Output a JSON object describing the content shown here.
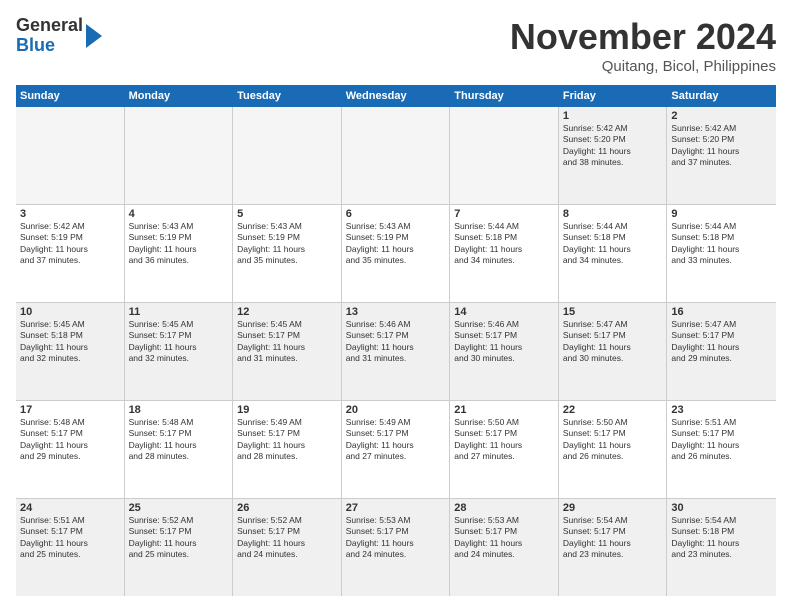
{
  "header": {
    "logo_general": "General",
    "logo_blue": "Blue",
    "month_title": "November 2024",
    "location": "Quitang, Bicol, Philippines"
  },
  "days_of_week": [
    "Sunday",
    "Monday",
    "Tuesday",
    "Wednesday",
    "Thursday",
    "Friday",
    "Saturday"
  ],
  "weeks": [
    [
      {
        "day": "",
        "empty": true,
        "text": ""
      },
      {
        "day": "",
        "empty": true,
        "text": ""
      },
      {
        "day": "",
        "empty": true,
        "text": ""
      },
      {
        "day": "",
        "empty": true,
        "text": ""
      },
      {
        "day": "",
        "empty": true,
        "text": ""
      },
      {
        "day": "1",
        "empty": false,
        "text": "Sunrise: 5:42 AM\nSunset: 5:20 PM\nDaylight: 11 hours\nand 38 minutes."
      },
      {
        "day": "2",
        "empty": false,
        "text": "Sunrise: 5:42 AM\nSunset: 5:20 PM\nDaylight: 11 hours\nand 37 minutes."
      }
    ],
    [
      {
        "day": "3",
        "empty": false,
        "text": "Sunrise: 5:42 AM\nSunset: 5:19 PM\nDaylight: 11 hours\nand 37 minutes."
      },
      {
        "day": "4",
        "empty": false,
        "text": "Sunrise: 5:43 AM\nSunset: 5:19 PM\nDaylight: 11 hours\nand 36 minutes."
      },
      {
        "day": "5",
        "empty": false,
        "text": "Sunrise: 5:43 AM\nSunset: 5:19 PM\nDaylight: 11 hours\nand 35 minutes."
      },
      {
        "day": "6",
        "empty": false,
        "text": "Sunrise: 5:43 AM\nSunset: 5:19 PM\nDaylight: 11 hours\nand 35 minutes."
      },
      {
        "day": "7",
        "empty": false,
        "text": "Sunrise: 5:44 AM\nSunset: 5:18 PM\nDaylight: 11 hours\nand 34 minutes."
      },
      {
        "day": "8",
        "empty": false,
        "text": "Sunrise: 5:44 AM\nSunset: 5:18 PM\nDaylight: 11 hours\nand 34 minutes."
      },
      {
        "day": "9",
        "empty": false,
        "text": "Sunrise: 5:44 AM\nSunset: 5:18 PM\nDaylight: 11 hours\nand 33 minutes."
      }
    ],
    [
      {
        "day": "10",
        "empty": false,
        "text": "Sunrise: 5:45 AM\nSunset: 5:18 PM\nDaylight: 11 hours\nand 32 minutes."
      },
      {
        "day": "11",
        "empty": false,
        "text": "Sunrise: 5:45 AM\nSunset: 5:17 PM\nDaylight: 11 hours\nand 32 minutes."
      },
      {
        "day": "12",
        "empty": false,
        "text": "Sunrise: 5:45 AM\nSunset: 5:17 PM\nDaylight: 11 hours\nand 31 minutes."
      },
      {
        "day": "13",
        "empty": false,
        "text": "Sunrise: 5:46 AM\nSunset: 5:17 PM\nDaylight: 11 hours\nand 31 minutes."
      },
      {
        "day": "14",
        "empty": false,
        "text": "Sunrise: 5:46 AM\nSunset: 5:17 PM\nDaylight: 11 hours\nand 30 minutes."
      },
      {
        "day": "15",
        "empty": false,
        "text": "Sunrise: 5:47 AM\nSunset: 5:17 PM\nDaylight: 11 hours\nand 30 minutes."
      },
      {
        "day": "16",
        "empty": false,
        "text": "Sunrise: 5:47 AM\nSunset: 5:17 PM\nDaylight: 11 hours\nand 29 minutes."
      }
    ],
    [
      {
        "day": "17",
        "empty": false,
        "text": "Sunrise: 5:48 AM\nSunset: 5:17 PM\nDaylight: 11 hours\nand 29 minutes."
      },
      {
        "day": "18",
        "empty": false,
        "text": "Sunrise: 5:48 AM\nSunset: 5:17 PM\nDaylight: 11 hours\nand 28 minutes."
      },
      {
        "day": "19",
        "empty": false,
        "text": "Sunrise: 5:49 AM\nSunset: 5:17 PM\nDaylight: 11 hours\nand 28 minutes."
      },
      {
        "day": "20",
        "empty": false,
        "text": "Sunrise: 5:49 AM\nSunset: 5:17 PM\nDaylight: 11 hours\nand 27 minutes."
      },
      {
        "day": "21",
        "empty": false,
        "text": "Sunrise: 5:50 AM\nSunset: 5:17 PM\nDaylight: 11 hours\nand 27 minutes."
      },
      {
        "day": "22",
        "empty": false,
        "text": "Sunrise: 5:50 AM\nSunset: 5:17 PM\nDaylight: 11 hours\nand 26 minutes."
      },
      {
        "day": "23",
        "empty": false,
        "text": "Sunrise: 5:51 AM\nSunset: 5:17 PM\nDaylight: 11 hours\nand 26 minutes."
      }
    ],
    [
      {
        "day": "24",
        "empty": false,
        "text": "Sunrise: 5:51 AM\nSunset: 5:17 PM\nDaylight: 11 hours\nand 25 minutes."
      },
      {
        "day": "25",
        "empty": false,
        "text": "Sunrise: 5:52 AM\nSunset: 5:17 PM\nDaylight: 11 hours\nand 25 minutes."
      },
      {
        "day": "26",
        "empty": false,
        "text": "Sunrise: 5:52 AM\nSunset: 5:17 PM\nDaylight: 11 hours\nand 24 minutes."
      },
      {
        "day": "27",
        "empty": false,
        "text": "Sunrise: 5:53 AM\nSunset: 5:17 PM\nDaylight: 11 hours\nand 24 minutes."
      },
      {
        "day": "28",
        "empty": false,
        "text": "Sunrise: 5:53 AM\nSunset: 5:17 PM\nDaylight: 11 hours\nand 24 minutes."
      },
      {
        "day": "29",
        "empty": false,
        "text": "Sunrise: 5:54 AM\nSunset: 5:17 PM\nDaylight: 11 hours\nand 23 minutes."
      },
      {
        "day": "30",
        "empty": false,
        "text": "Sunrise: 5:54 AM\nSunset: 5:18 PM\nDaylight: 11 hours\nand 23 minutes."
      }
    ]
  ]
}
